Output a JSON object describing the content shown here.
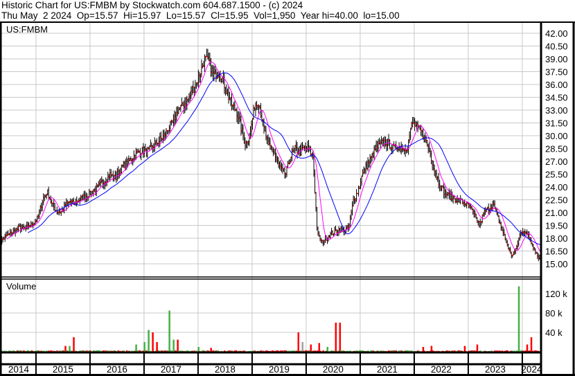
{
  "header": {
    "title_line": "Historic Chart for US:FMBM by Stockwatch.com 604.687.1500 - (c) 2024",
    "quote_line": "Thu May  2 2024  Op=15.57  Hi=15.97  Lo=15.57  Cl=15.95  Vol=1,950  Year hi=40.00  lo=15.00"
  },
  "chart_data": [
    {
      "type": "ohlc",
      "title": "US:FMBM",
      "ylim": [
        15.0,
        42.0
      ],
      "y_ticks": [
        "42.00",
        "40.50",
        "39.00",
        "37.50",
        "36.00",
        "34.50",
        "33.00",
        "31.50",
        "30.00",
        "28.50",
        "27.00",
        "25.50",
        "24.00",
        "22.50",
        "21.00",
        "19.50",
        "18.00",
        "16.50",
        "15.00"
      ],
      "x_ticks": [
        "2014",
        "2015",
        "2016",
        "2017",
        "2018",
        "2019",
        "2020",
        "2021",
        "2022",
        "2023",
        "2024"
      ],
      "grid": true,
      "x_start": "2014-04",
      "x_step": "month",
      "monthly_close": [
        17.6,
        17.8,
        18.3,
        18.6,
        18.9,
        19.3,
        19.0,
        19.5,
        19.8,
        20.5,
        22.5,
        23.5,
        22.0,
        21.2,
        21.0,
        21.8,
        22.3,
        22.0,
        22.5,
        22.8,
        23.0,
        23.5,
        23.8,
        24.5,
        24.8,
        25.5,
        25.0,
        26.0,
        26.5,
        27.0,
        27.5,
        28.0,
        28.3,
        28.0,
        28.5,
        29.0,
        29.5,
        30.0,
        31.0,
        31.5,
        33.0,
        33.5,
        34.0,
        35.0,
        36.0,
        37.5,
        39.0,
        38.5,
        37.0,
        37.5,
        36.5,
        35.0,
        33.5,
        33.0,
        31.0,
        29.0,
        30.0,
        33.5,
        34.0,
        31.0,
        29.0,
        28.5,
        27.0,
        26.0,
        25.5,
        27.5,
        28.5,
        28.0,
        28.5,
        28.5,
        27.5,
        18.5,
        17.5,
        18.0,
        18.5,
        18.8,
        19.0,
        19.0,
        19.2,
        22.5,
        23.5,
        25.5,
        26.5,
        27.5,
        28.5,
        29.0,
        29.3,
        29.0,
        28.5,
        28.8,
        28.5,
        28.7,
        31.5,
        31.0,
        30.5,
        29.5,
        28.0,
        26.0,
        24.5,
        23.5,
        23.0,
        22.8,
        22.5,
        22.3,
        22.0,
        21.5,
        20.5,
        19.5,
        21.0,
        21.5,
        22.0,
        20.5,
        19.0,
        17.5,
        16.0,
        16.5,
        18.5,
        19.0,
        18.0,
        17.0,
        15.8,
        15.95
      ],
      "series": [
        {
          "name": "",
          "kind": "moving-average-short",
          "color": "#ff00ff"
        },
        {
          "name": "",
          "kind": "moving-average-long",
          "color": "#0000ff"
        }
      ],
      "colors": {
        "bars": "#000000",
        "close_tick": "#ff0000"
      }
    },
    {
      "type": "bar",
      "title": "Volume",
      "ylim": [
        0,
        150000
      ],
      "y_ticks": [
        "120 k",
        "80 k",
        "40 k"
      ],
      "volume_k_spikes": {
        "16": 30,
        "15": 12,
        "30": 15,
        "32": 20,
        "33": 45,
        "34": 40,
        "35": 20,
        "38": 85,
        "39": 25,
        "44": 10,
        "47": 8,
        "66": 40,
        "67": 20,
        "69": 15,
        "71": 18,
        "73": 10,
        "75": 60,
        "94": 10,
        "96": 12,
        "103": 12,
        "106": 15,
        "115": 135,
        "117": 15,
        "118": 30
      },
      "volume_k_baseline": 2,
      "colors": {
        "up": "#44b044",
        "down": "#ff0000",
        "unchanged": "#a0a0a0"
      }
    }
  ]
}
